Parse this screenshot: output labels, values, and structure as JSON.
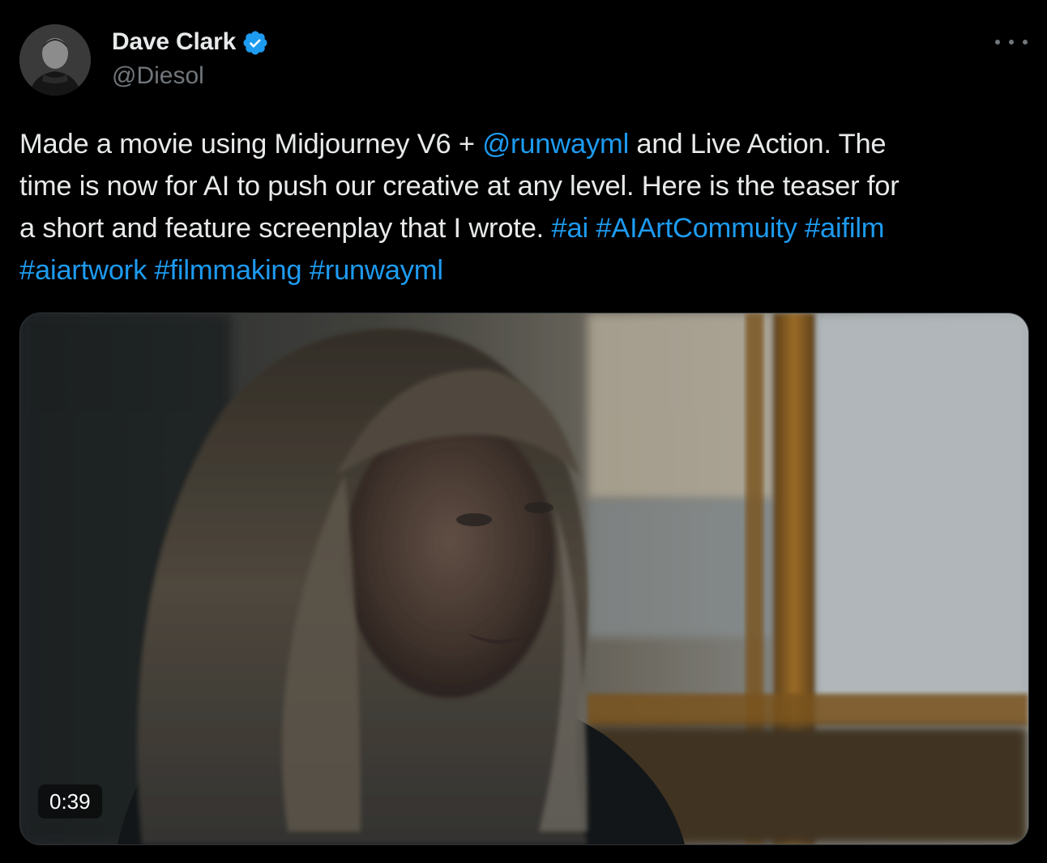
{
  "author": {
    "display_name": "Dave Clark",
    "handle": "@Diesol",
    "verified": true,
    "avatar_icon": "user-avatar"
  },
  "tweet": {
    "line_1": {
      "before": "Made a movie using Midjourney V6 + ",
      "mention": "@runwayml",
      "after": " and Live Action. The"
    },
    "line_2": "time is now for AI to push our creative at any level. Here is the teaser for",
    "line_3": {
      "before": "a short and feature screenplay that I wrote. ",
      "hashtags": [
        "#ai",
        "#AIArtCommuity",
        "#aifilm"
      ]
    },
    "line_4": {
      "hashtags": [
        "#aiartwork",
        "#filmmaking",
        "#runwayml"
      ]
    }
  },
  "media": {
    "type": "video",
    "duration": "0:39"
  },
  "colors": {
    "background": "#000000",
    "text": "#e7e9ea",
    "secondary": "#71767b",
    "link": "#1d9bf0",
    "verified_badge": "#1d9bf0"
  },
  "icons": {
    "more": "more-horizontal-icon",
    "verified": "verified-badge-icon"
  }
}
